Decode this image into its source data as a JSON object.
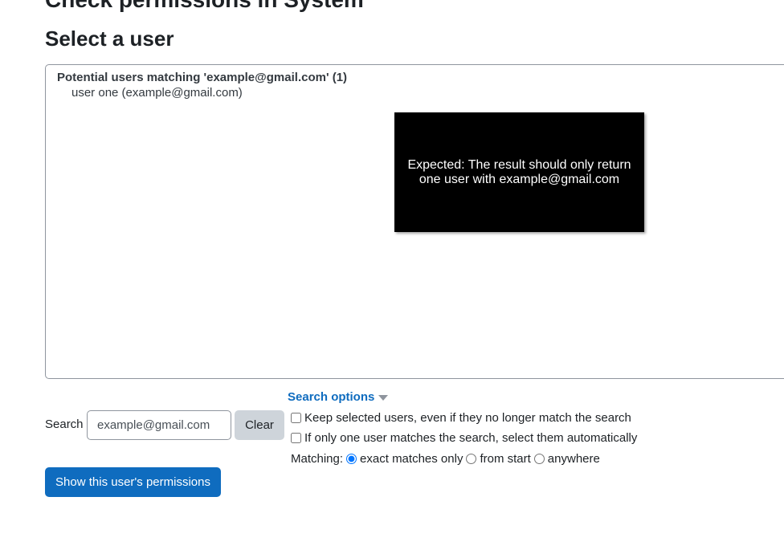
{
  "page": {
    "heading": "Check permissions in System",
    "section_heading": "Select a user"
  },
  "user_list": {
    "group_label": "Potential users matching 'example@gmail.com' (1)",
    "options": [
      "user one (example@gmail.com)"
    ]
  },
  "annotation": {
    "text": "Expected: The result should only return one user with example@gmail.com"
  },
  "search": {
    "label": "Search",
    "value": "example@gmail.com",
    "clear_label": "Clear"
  },
  "search_options": {
    "toggle_label": "Search options",
    "keep_selected_label": "Keep selected users, even if they no longer match the search",
    "keep_selected_checked": false,
    "auto_select_label": "If only one user matches the search, select them automatically",
    "auto_select_checked": false,
    "matching_label": "Matching:",
    "matching_options": [
      "exact matches only",
      "from start",
      "anywhere"
    ],
    "matching_selected": "exact matches only"
  },
  "actions": {
    "show_permissions_label": "Show this user's permissions"
  },
  "colors": {
    "primary": "#0f6cbf",
    "secondary_button": "#ced4da",
    "annotation_bg": "#000000"
  }
}
